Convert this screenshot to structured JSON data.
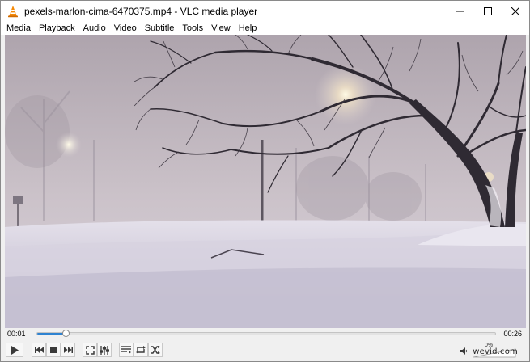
{
  "window": {
    "title": "pexels-marlon-cima-6470375.mp4 - VLC media player",
    "controls": [
      "minimize-icon",
      "maximize-icon",
      "close-icon"
    ]
  },
  "menu": {
    "items": [
      {
        "label": "Media"
      },
      {
        "label": "Playback"
      },
      {
        "label": "Audio"
      },
      {
        "label": "Video"
      },
      {
        "label": "Subtitle"
      },
      {
        "label": "Tools"
      },
      {
        "label": "View"
      },
      {
        "label": "Help"
      }
    ]
  },
  "player": {
    "time_elapsed": "00:01",
    "time_total": "00:26",
    "progress": 0.061,
    "volume_percent_label": "0%",
    "volume_level": 0.0,
    "watermark": "wevid.com",
    "accent_color": "#2f83d1",
    "icons": {
      "play": "play-icon",
      "previous": "previous-icon",
      "stop": "stop-icon",
      "next": "next-icon",
      "fullscreen": "fullscreen-icon",
      "extended_settings": "equalizer-icon",
      "playlist": "playlist-icon",
      "loop": "loop-icon",
      "shuffle": "shuffle-icon",
      "mute": "speaker-icon"
    }
  }
}
